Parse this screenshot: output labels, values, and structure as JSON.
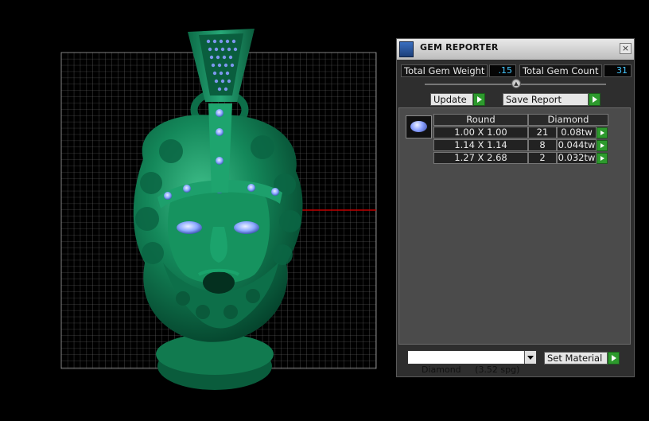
{
  "panel": {
    "title": "GEM REPORTER",
    "close_label": "×",
    "total_weight_label": "Total Gem Weight",
    "total_weight_value": ".15",
    "total_count_label": "Total Gem Count",
    "total_count_value": "31",
    "update_label": "Update",
    "save_report_label": "Save Report",
    "table": {
      "headers": [
        "Round",
        "Diamond"
      ],
      "rows": [
        {
          "size": "1.00 X 1.00",
          "count": "21",
          "weight": "0.08tw"
        },
        {
          "size": "1.14 X 1.14",
          "count": "8",
          "weight": "0.044tw"
        },
        {
          "size": "1.27 X 2.68",
          "count": "2",
          "weight": "0.032tw"
        }
      ]
    },
    "material_select_value": "Diamond     (3.52 spg)",
    "set_material_label": "Set Material"
  },
  "colors": {
    "model_green": "#0f7a52",
    "accent_value": "#46c8ff",
    "axis_red": "#c00000",
    "play_green": "#2d9a2d"
  },
  "icons": {
    "title": "gem-reporter-icon",
    "gem": "round-gem-icon",
    "play": "play-arrow-icon",
    "dropdown": "chevron-down-icon"
  }
}
